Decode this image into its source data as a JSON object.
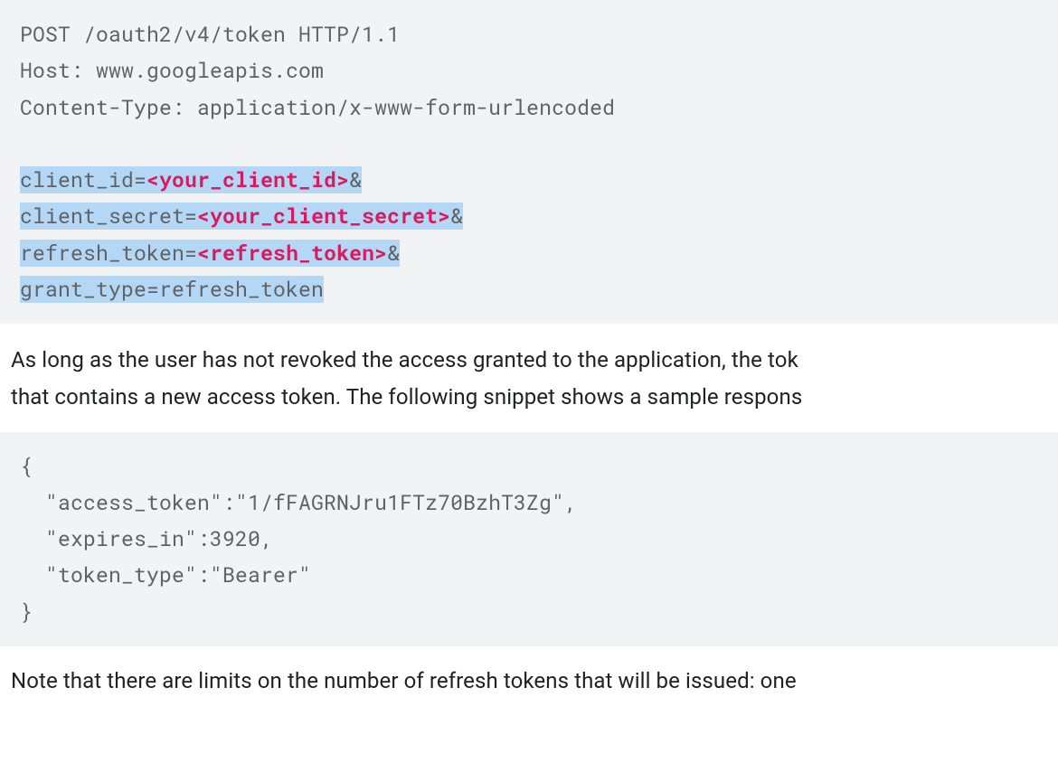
{
  "request": {
    "line1": "POST /oauth2/v4/token HTTP/1.1",
    "host_label": "Host: ",
    "host_value": "www.googleapis.com",
    "ct_line": "Content-Type: application/x-www-form-urlencoded",
    "body": {
      "l1_pre": "client_id=",
      "l1_ph": "<your_client_id>",
      "l1_post": "&",
      "l2_pre": "client_secret=",
      "l2_ph": "<your_client_secret>",
      "l2_post": "&",
      "l3_pre": "refresh_token=",
      "l3_ph": "<refresh_token>",
      "l3_post": "&",
      "l4": "grant_type=refresh_token"
    }
  },
  "prose1": "As long as the user has not revoked the access granted to the application, the tok",
  "prose2": "that contains a new access token. The following snippet shows a sample respons",
  "response": {
    "open": "{",
    "l1": "  \"access_token\":\"1/fFAGRNJru1FTz70BzhT3Zg\",",
    "l2": "  \"expires_in\":3920,",
    "l3": "  \"token_type\":\"Bearer\"",
    "close": "}"
  },
  "note": "Note that there are limits on the number of refresh tokens that will be issued: one"
}
